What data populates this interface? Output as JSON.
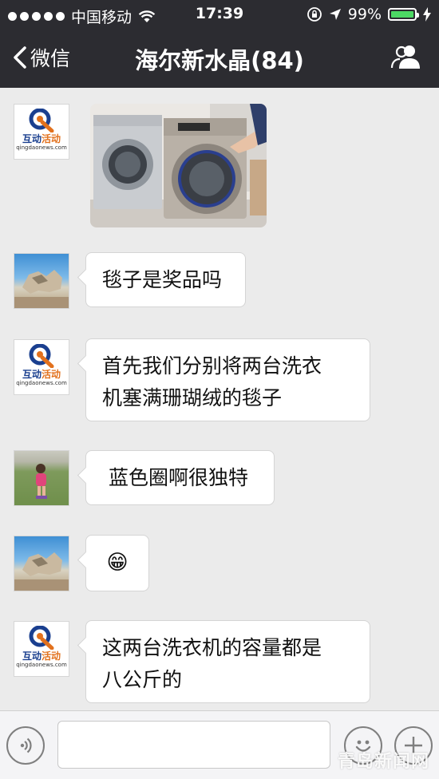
{
  "status_bar": {
    "carrier": "中国移动",
    "time": "17:39",
    "battery": "99%",
    "battery_level": 0.99
  },
  "nav": {
    "back_label": "微信",
    "title": "海尔新水晶(84)"
  },
  "avatars": {
    "hudong_brand_left": "互动",
    "hudong_brand_right": "活动",
    "hudong_url": "qingdaonews.com"
  },
  "messages": [
    {
      "type": "image",
      "avatar": "hudong-logo",
      "alt": "washing machines photo"
    },
    {
      "type": "text",
      "avatar": "rock-photo",
      "lines": [
        "毯子是奖品吗"
      ]
    },
    {
      "type": "text",
      "avatar": "hudong-logo",
      "lines": [
        "首先我们分别将两台洗衣",
        "机塞满珊瑚绒的毯子"
      ]
    },
    {
      "type": "text",
      "avatar": "kid-photo",
      "lines": [
        " 蓝色圈啊很独特"
      ]
    },
    {
      "type": "emoji",
      "avatar": "rock-photo",
      "emoji": "😁"
    },
    {
      "type": "text",
      "avatar": "hudong-logo",
      "lines": [
        "这两台洗衣机的容量都是",
        "八公斤的"
      ]
    }
  ],
  "input": {
    "placeholder": ""
  },
  "watermark": "青岛新闻网",
  "colors": {
    "nav_bg": "#2c2c31",
    "chat_bg": "#ebebeb",
    "bubble_bg": "#ffffff",
    "battery_fill": "#4cd964"
  }
}
